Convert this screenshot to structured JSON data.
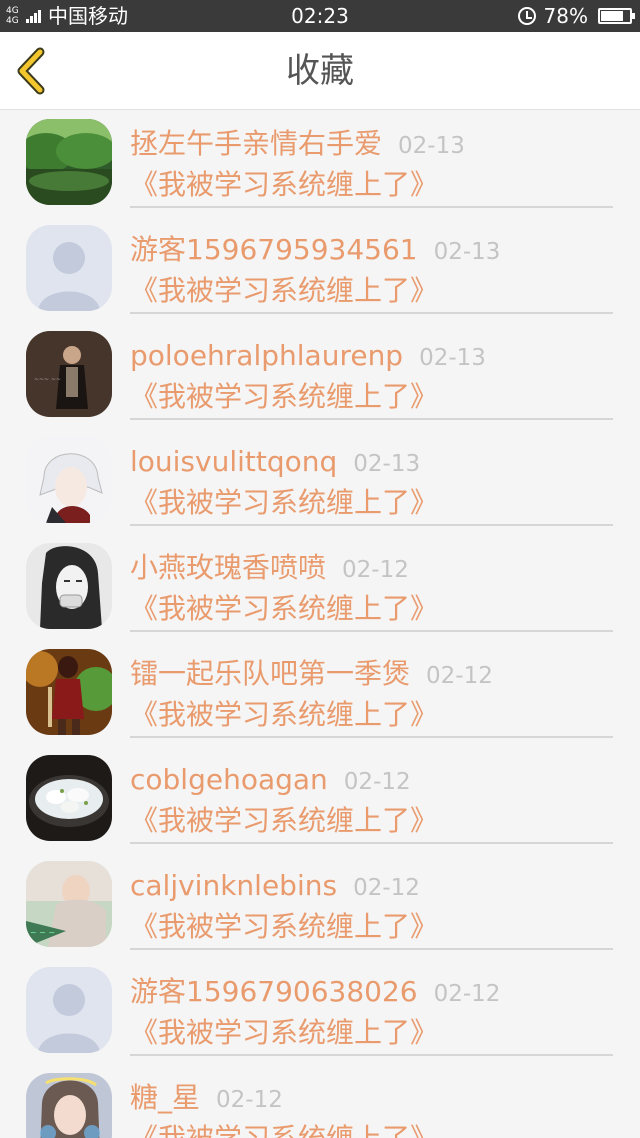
{
  "status_bar": {
    "network": "4G 4G",
    "carrier": "中国移动",
    "time": "02:23",
    "battery": "78%",
    "battery_level": 0.78
  },
  "header": {
    "title": "收藏",
    "back_icon": "chevron-left-icon"
  },
  "colors": {
    "accent": "#e99b6e",
    "date": "#c4c4c4",
    "back_icon": "#f3c62e"
  },
  "favorites": [
    {
      "user": "拯左午手亲情右手爱",
      "date": "02-13",
      "book": "《我被学习系统缠上了》",
      "avatar": "landscape"
    },
    {
      "user": "游客1596795934561",
      "date": "02-13",
      "book": "《我被学习系统缠上了》",
      "avatar": "default"
    },
    {
      "user": "poloehralphlaurenp",
      "date": "02-13",
      "book": "《我被学习系统缠上了》",
      "avatar": "dark-figure"
    },
    {
      "user": "louisvulittqonq",
      "date": "02-13",
      "book": "《我被学习系统缠上了》",
      "avatar": "anime-white-hair"
    },
    {
      "user": "小燕玫瑰香喷喷",
      "date": "02-12",
      "book": "《我被学习系统缠上了》",
      "avatar": "sketch-girl"
    },
    {
      "user": "镭一起乐队吧第一季煲",
      "date": "02-12",
      "book": "《我被学习系统缠上了》",
      "avatar": "game-warrior"
    },
    {
      "user": "coblgehoagan",
      "date": "02-12",
      "book": "《我被学习系统缠上了》",
      "avatar": "dumpling-soup"
    },
    {
      "user": "caljvinknlebins",
      "date": "02-12",
      "book": "《我被学习系统缠上了》",
      "avatar": "photo-girl"
    },
    {
      "user": "游客1596790638026",
      "date": "02-12",
      "book": "《我被学习系统缠上了》",
      "avatar": "default"
    },
    {
      "user": "糖_星",
      "date": "02-12",
      "book": "《我被学习系统缠上了》",
      "avatar": "portrait-girl"
    }
  ]
}
